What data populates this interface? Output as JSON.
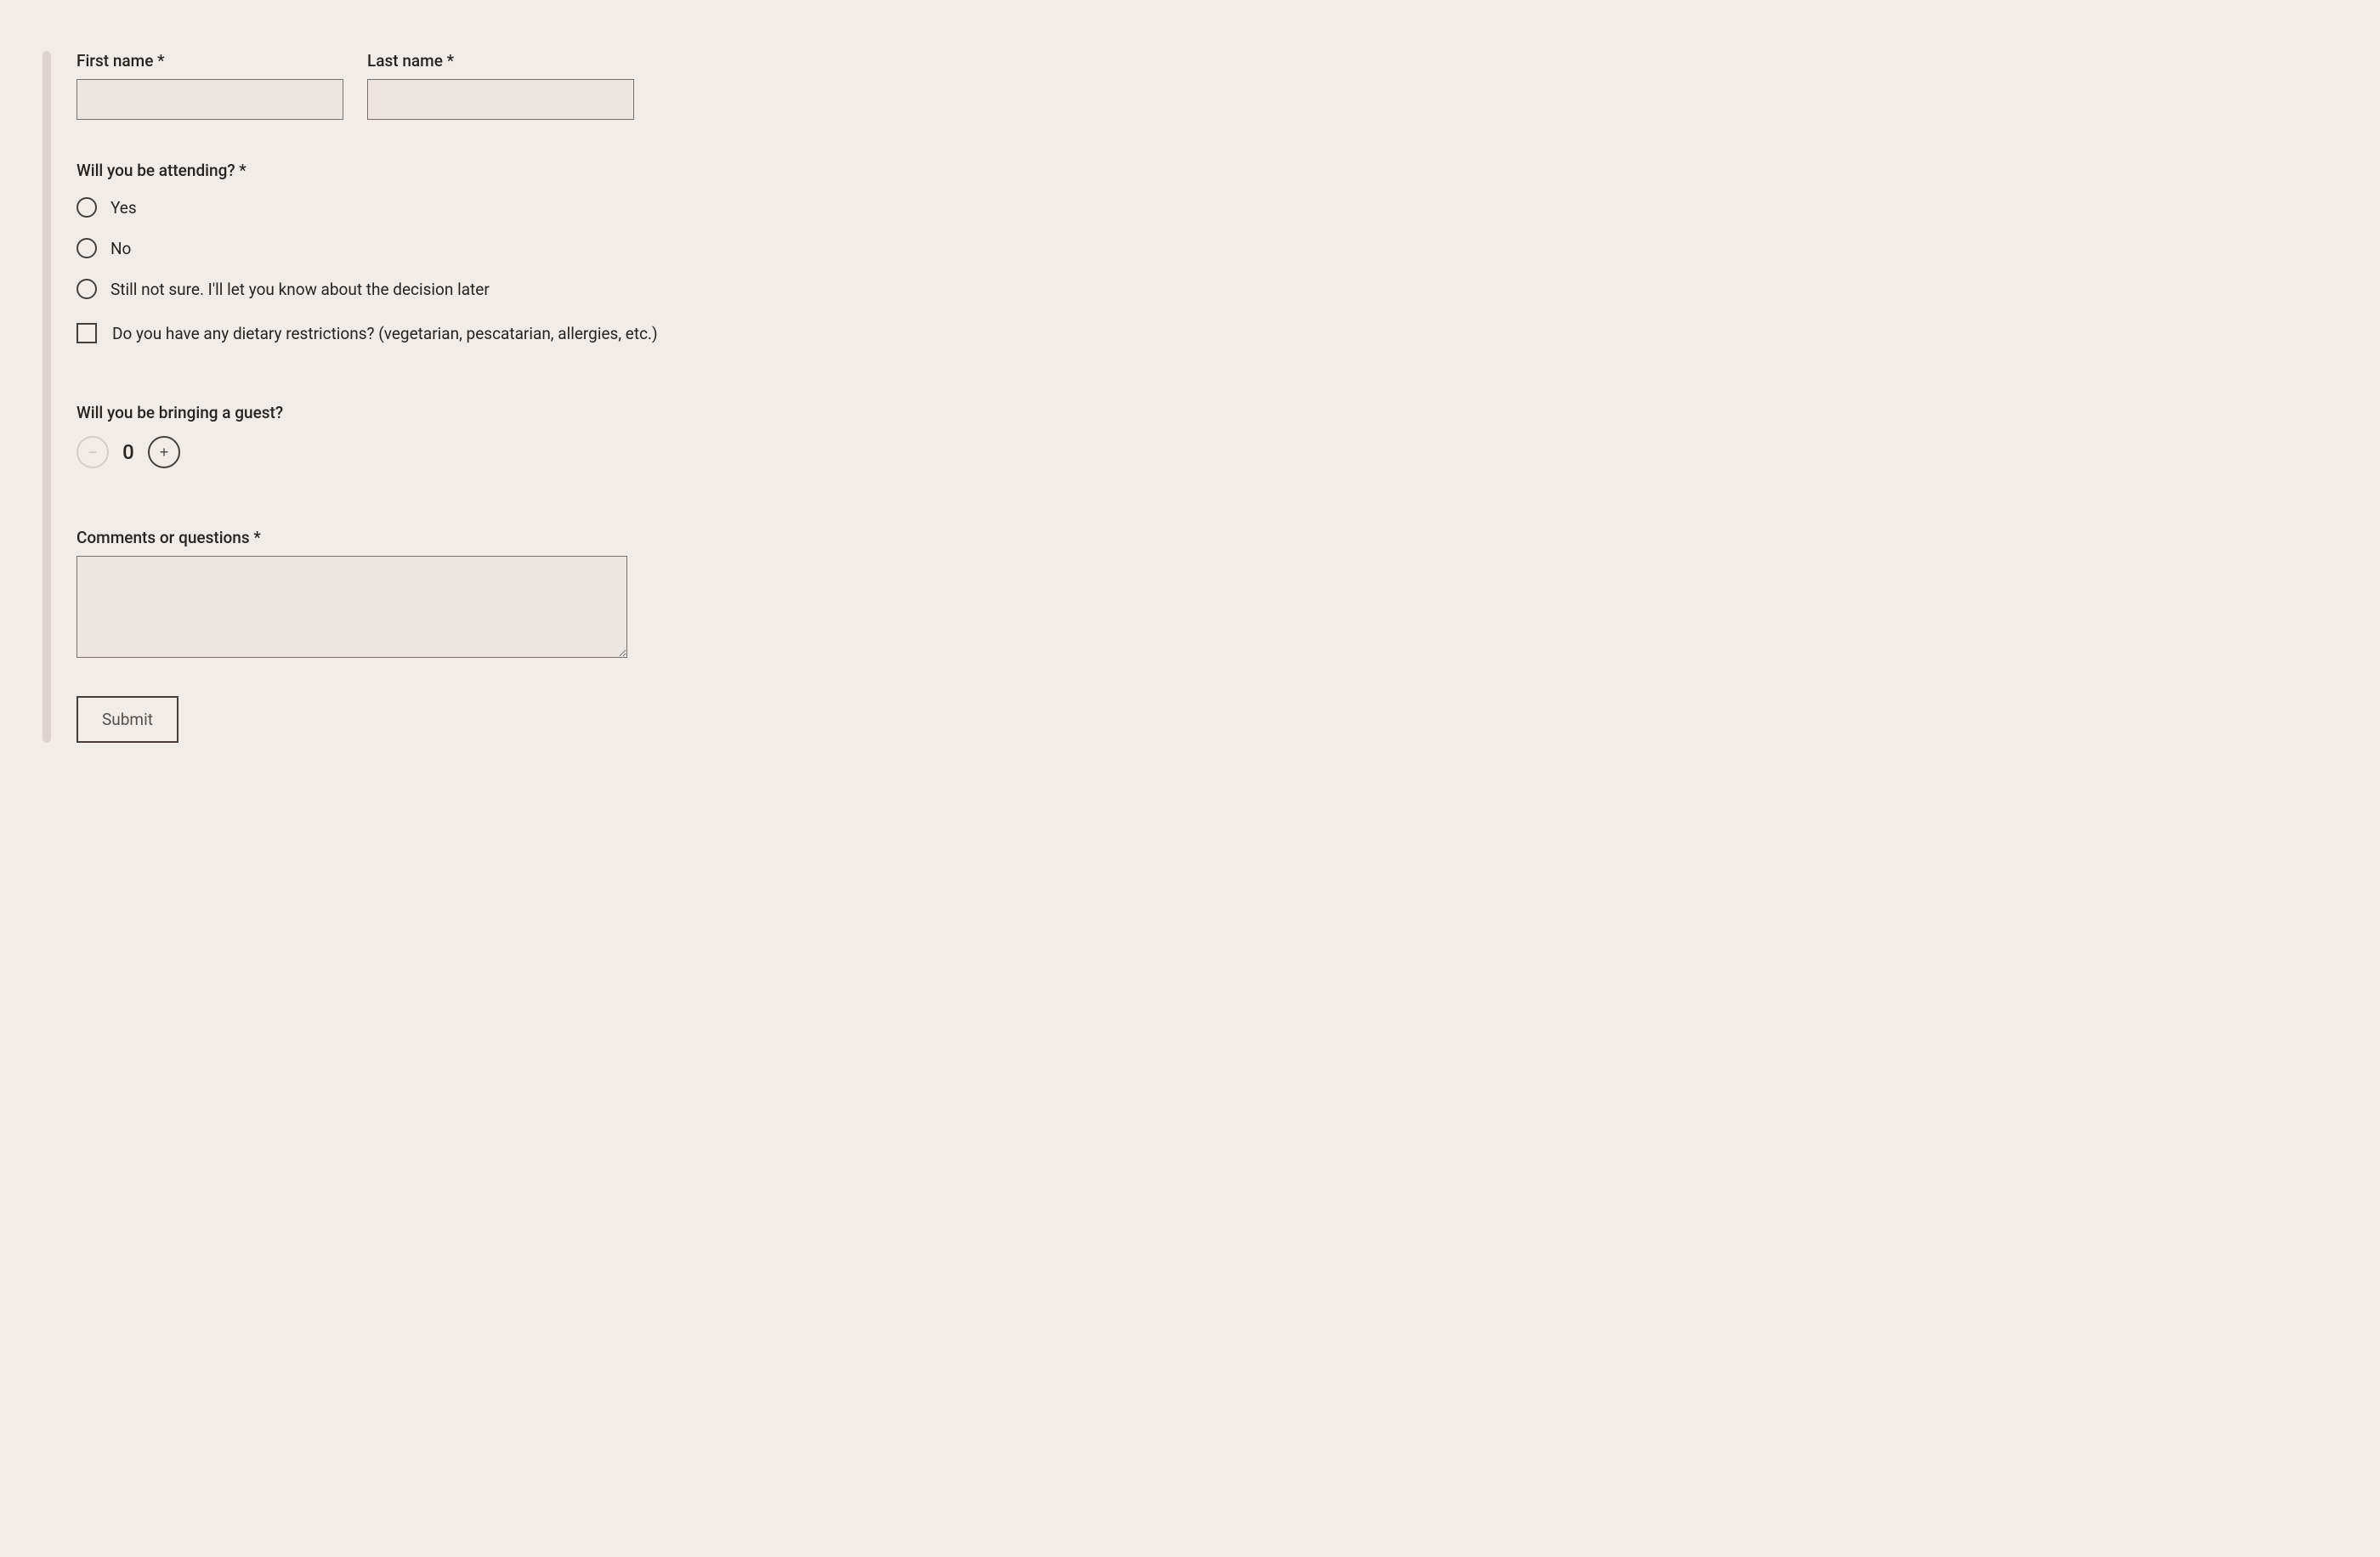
{
  "form": {
    "first_name": {
      "label": "First name *",
      "value": ""
    },
    "last_name": {
      "label": "Last name *",
      "value": ""
    },
    "attending": {
      "label": "Will you be attending? *",
      "options": [
        "Yes",
        "No",
        "Still not sure. I'll let you know about the decision later"
      ]
    },
    "dietary": {
      "label": "Do you have any dietary restrictions? (vegetarian, pescatarian, allergies, etc.)"
    },
    "guest": {
      "label": "Will you be bringing a guest?",
      "value": "0",
      "minus": "−",
      "plus": "+"
    },
    "comments": {
      "label": "Comments or questions *",
      "value": ""
    },
    "submit_label": "Submit"
  }
}
